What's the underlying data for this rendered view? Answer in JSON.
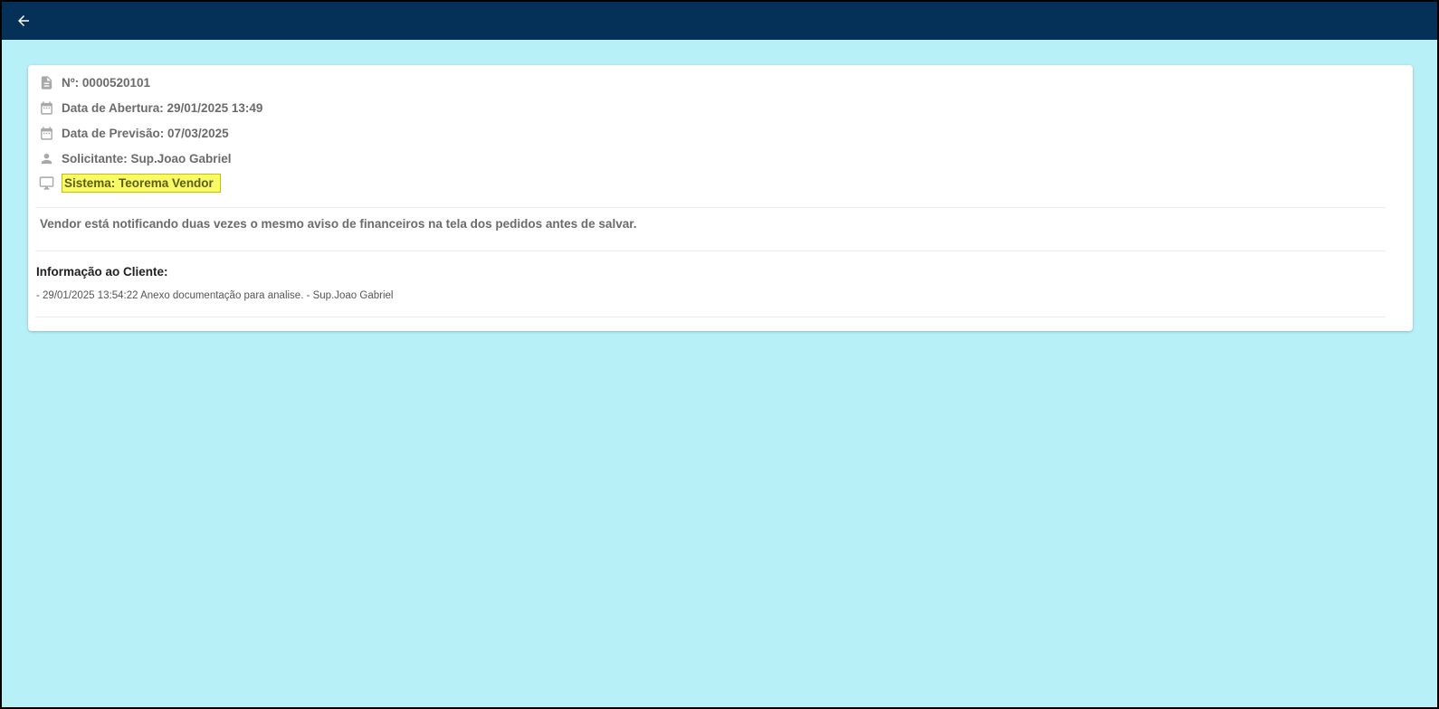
{
  "header": {
    "back_icon": "arrow-left-icon",
    "background_color": "#053158"
  },
  "ticket": {
    "number": "Nº: 0000520101",
    "opened": "Data de Abertura: 29/01/2025 13:49",
    "forecast": "Data de Previsão: 07/03/2025",
    "requester": "Solicitante: Sup.Joao Gabriel",
    "system": "Sistema: Teorema Vendor",
    "description": "Vendor está notificando duas vezes o mesmo aviso de financeiros na tela dos pedidos antes de salvar."
  },
  "client_info": {
    "title": "Informação ao Cliente:",
    "entries": [
      "- 29/01/2025 13:54:22 Anexo documentação para analise. - Sup.Joao Gabriel"
    ]
  },
  "icons": {
    "number": "document-icon",
    "opened": "calendar-icon",
    "forecast": "calendar-icon",
    "requester": "person-icon",
    "system": "monitor-icon"
  },
  "colors": {
    "page_background": "#b8f0f8",
    "highlight": "#f8fa66"
  }
}
